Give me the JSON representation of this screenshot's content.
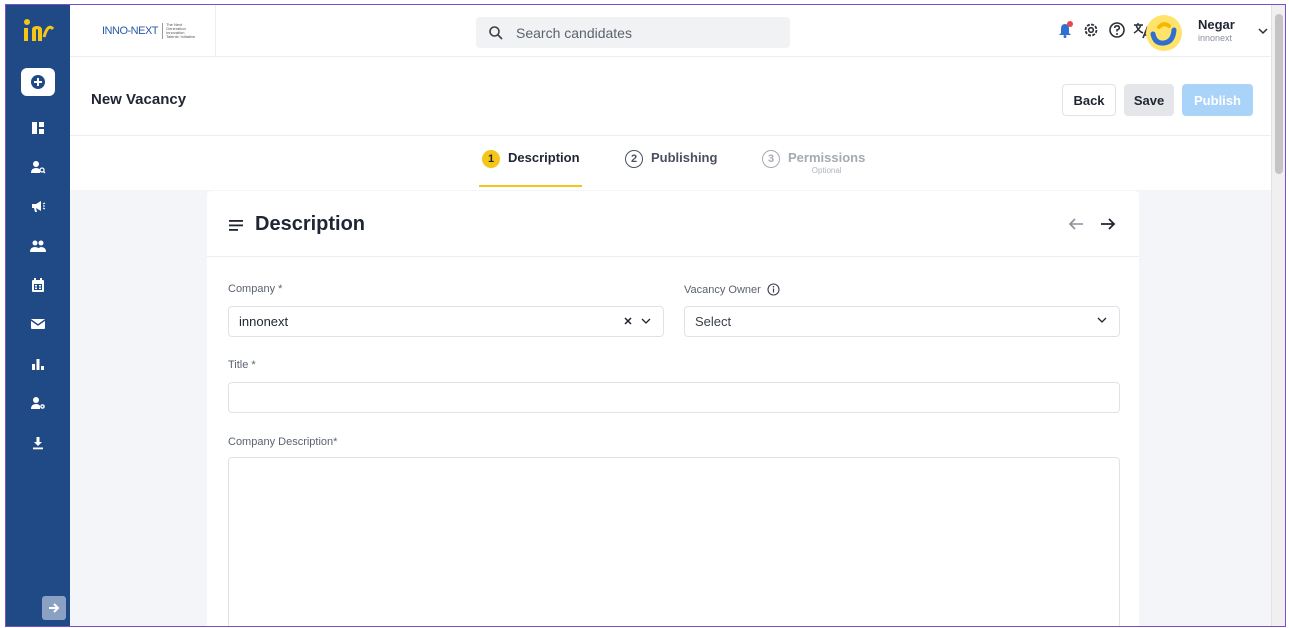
{
  "brand": {
    "logo_icon": "innonext-logo-icon",
    "name": "INNO-NEXT",
    "tagline": "The Next Generation Innovation Talents' Initiative"
  },
  "search": {
    "placeholder": "Search candidates"
  },
  "user": {
    "name": "Negar",
    "org": "innonext"
  },
  "page": {
    "title": "New Vacancy"
  },
  "actions": {
    "back": "Back",
    "save": "Save",
    "publish": "Publish"
  },
  "steps": [
    {
      "num": "1",
      "label": "Description",
      "sub": ""
    },
    {
      "num": "2",
      "label": "Publishing",
      "sub": ""
    },
    {
      "num": "3",
      "label": "Permissions",
      "sub": "Optional"
    }
  ],
  "card": {
    "title": "Description"
  },
  "form": {
    "company_label": "Company *",
    "company_value": "innonext",
    "owner_label": "Vacancy Owner",
    "owner_value": "Select",
    "title_label": "Title *",
    "title_value": "",
    "company_desc_label": "Company Description*",
    "company_desc_value": ""
  },
  "sidebar": {
    "items": [
      "add",
      "dashboard",
      "candidates",
      "campaigns",
      "users",
      "calendar",
      "mail",
      "reports",
      "user-settings",
      "download"
    ]
  },
  "colors": {
    "sidebar": "#1f4a86",
    "accent": "#f5c518",
    "publish": "#a9d3f8",
    "frame": "#7b4fc9"
  }
}
